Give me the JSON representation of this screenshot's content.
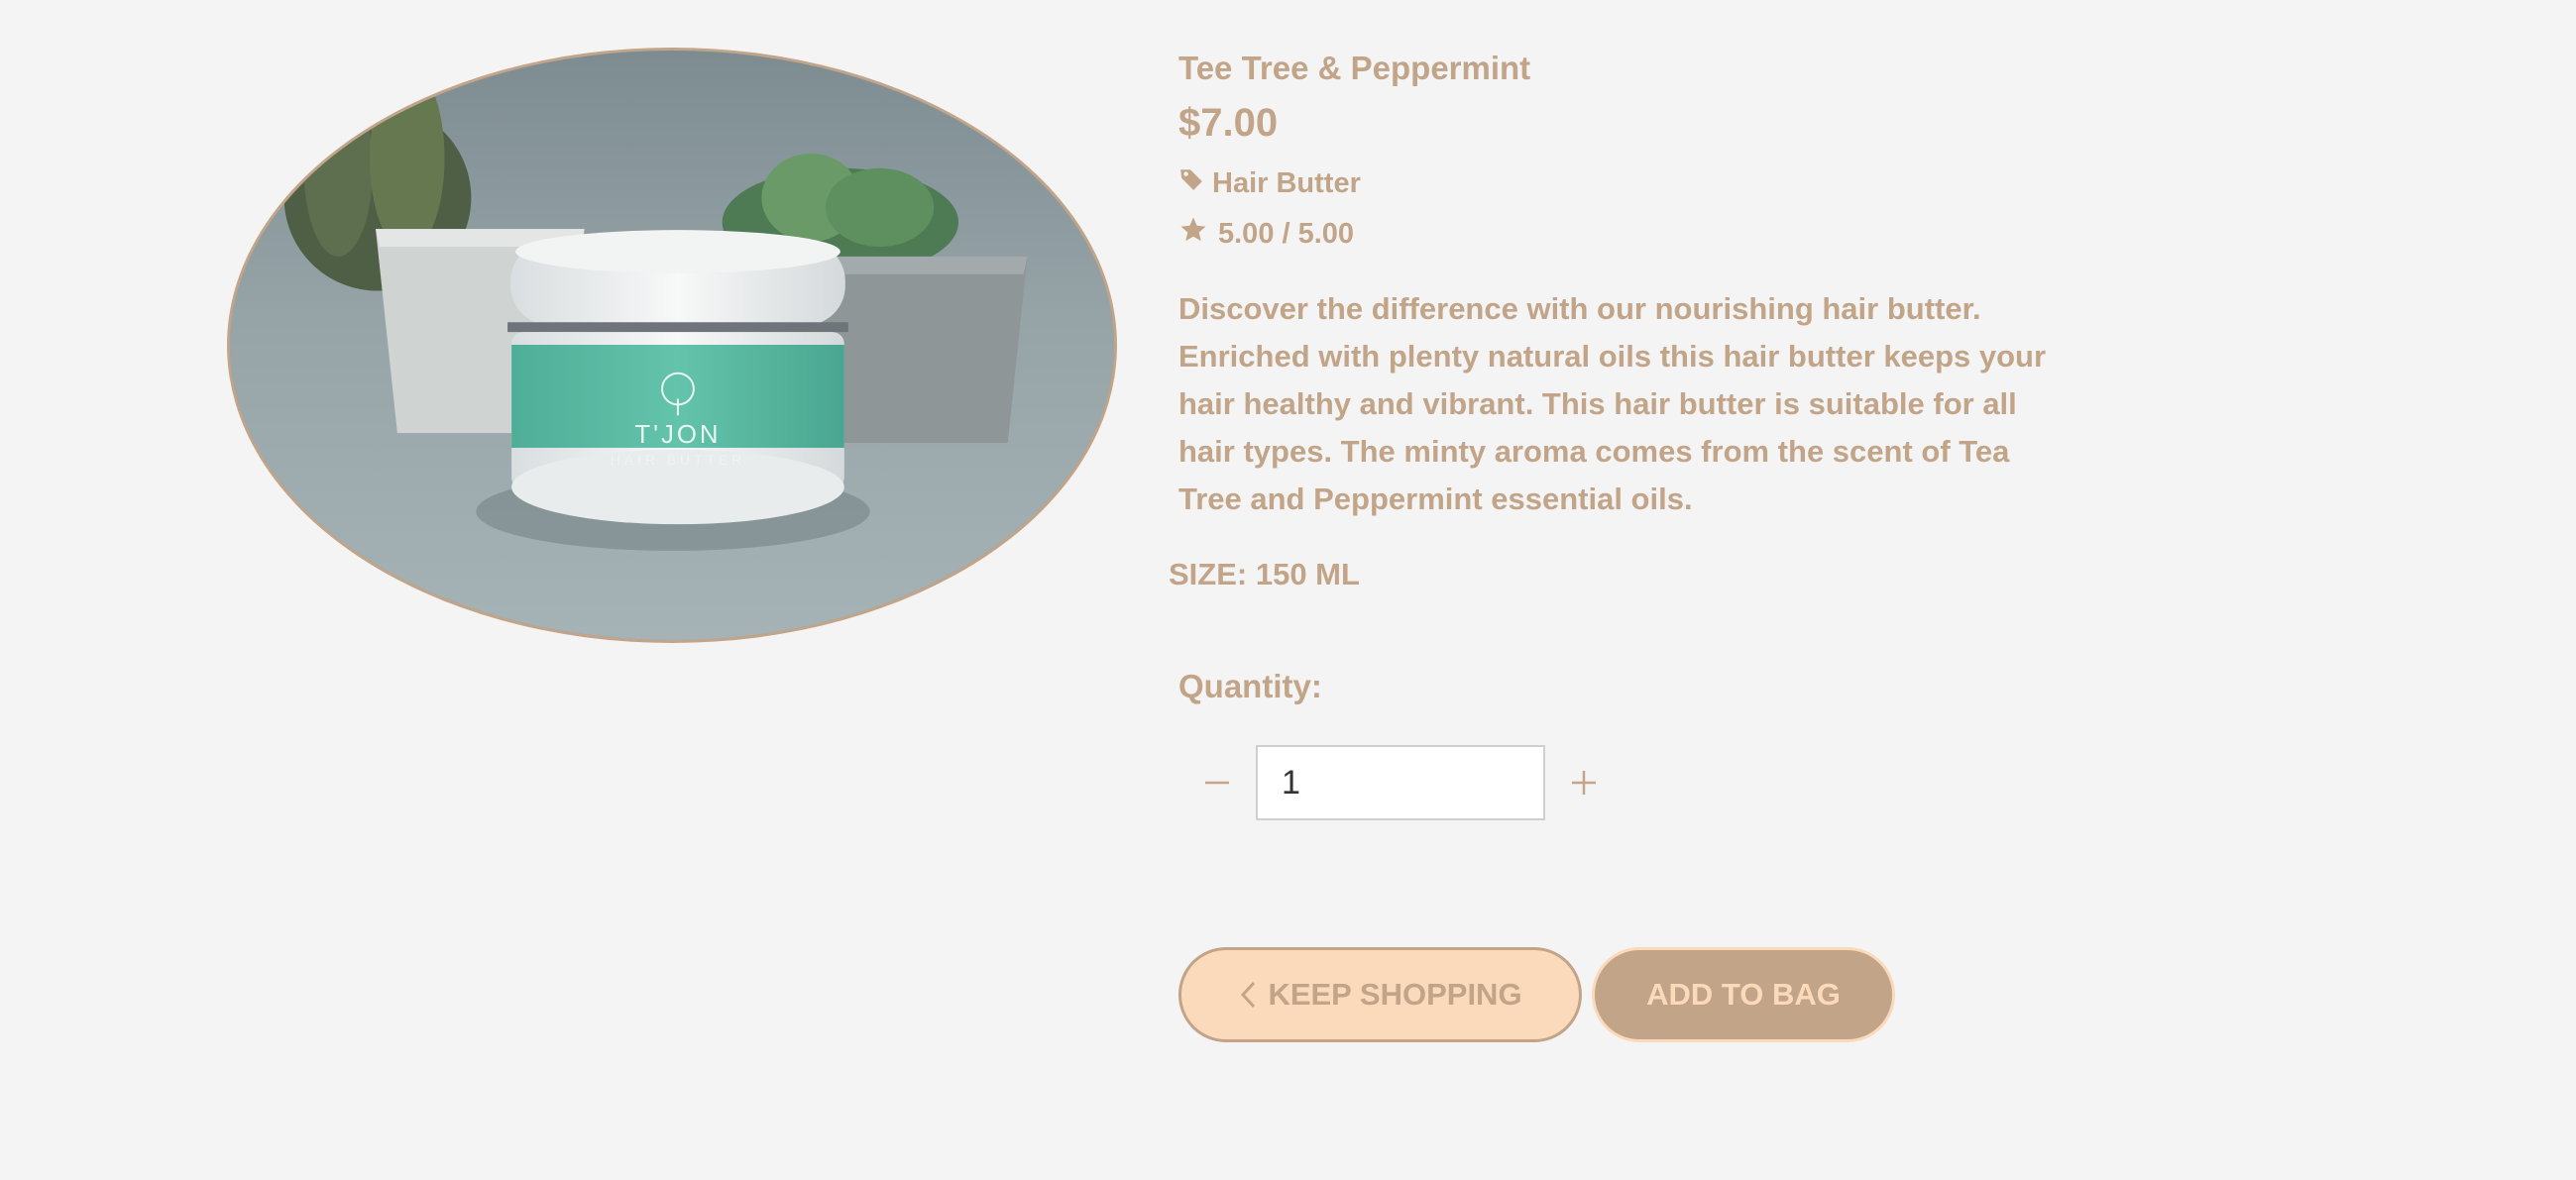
{
  "product": {
    "title": "Tee Tree & Peppermint",
    "price": "$7.00",
    "category": "Hair Butter",
    "rating": "5.00 / 5.00",
    "description": "Discover the difference with our nourishing hair butter. Enriched with plenty natural oils this hair butter keeps your hair healthy and vibrant. This hair butter is suitable for all hair types. The minty aroma comes from the scent of Tea Tree and Peppermint essential oils.",
    "size": "SIZE: 150 ML",
    "image_label_brand": "T'JON",
    "image_label_sub": "HAIR BUTTER"
  },
  "quantity": {
    "label": "Quantity:",
    "value": "1"
  },
  "actions": {
    "keep_shopping": "KEEP SHOPPING",
    "add_to_bag": "ADD TO BAG"
  },
  "icons": {
    "category": "tag-icon",
    "rating": "star-icon",
    "decrease": "minus-icon",
    "increase": "plus-icon",
    "back": "chevron-left-icon"
  },
  "colors": {
    "accent": "#c2a488",
    "accent_light": "#fbd9bb",
    "background": "#f4f4f4",
    "jar_label": "#5fbfa8"
  }
}
